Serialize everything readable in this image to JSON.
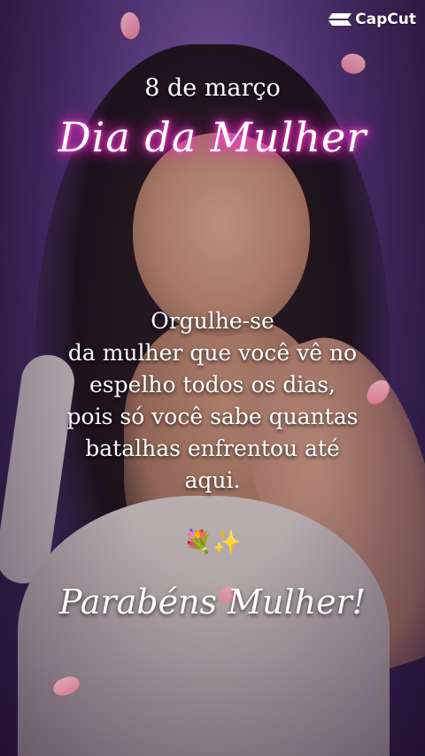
{
  "brand": {
    "name": "CapCut",
    "icon": "capcut-logo-icon"
  },
  "header": {
    "date": "8 de março",
    "title": "Dia da Mulher"
  },
  "message": {
    "lines": [
      "Orgulhe-se",
      "da mulher que você vê no",
      "espelho todos os dias,",
      "pois só você sabe quantas",
      "batalhas enfrentou até",
      "aqui."
    ]
  },
  "decoration": {
    "emoji": "💐✨"
  },
  "closing": {
    "text": "Parabéns Mulher!"
  },
  "colors": {
    "background": "#5f3f8a",
    "title_glow": "#ff2bd0",
    "text": "#ffffff",
    "petal": "#e0788f"
  }
}
